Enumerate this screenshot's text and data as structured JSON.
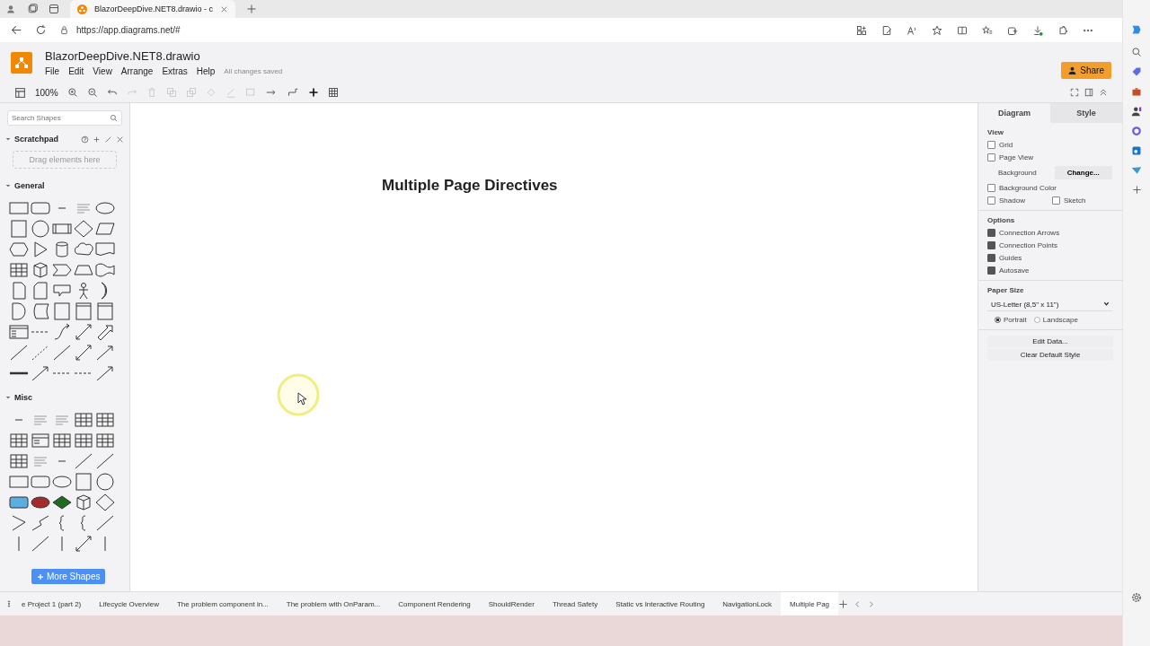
{
  "browser": {
    "tab_title": "BlazorDeepDive.NET8.drawio - c",
    "url": "https://app.diagrams.net/#"
  },
  "app": {
    "file_name": "BlazorDeepDive.NET8.drawio",
    "menu": [
      "File",
      "Edit",
      "View",
      "Arrange",
      "Extras",
      "Help"
    ],
    "save_status": "All changes saved",
    "share_label": "Share",
    "zoom": "100%"
  },
  "sidebar": {
    "search_placeholder": "Search Shapes",
    "scratchpad": {
      "title": "Scratchpad",
      "drop_hint": "Drag elements here"
    },
    "sections": [
      {
        "title": "General",
        "expanded": true
      },
      {
        "title": "Misc",
        "expanded": true
      }
    ],
    "more_shapes": "More Shapes"
  },
  "canvas": {
    "heading": "Multiple Page Directives"
  },
  "format_panel": {
    "tabs": [
      {
        "label": "Diagram",
        "selected": true
      },
      {
        "label": "Style",
        "selected": false
      }
    ],
    "view": {
      "title": "View",
      "grid": {
        "label": "Grid",
        "checked": false
      },
      "page_view": {
        "label": "Page View",
        "checked": false
      },
      "background_label": "Background",
      "change_button": "Change...",
      "background_color": {
        "label": "Background Color",
        "checked": false
      },
      "shadow": {
        "label": "Shadow",
        "checked": false
      },
      "sketch": {
        "label": "Sketch",
        "checked": false
      }
    },
    "options": {
      "title": "Options",
      "items": [
        {
          "label": "Connection Arrows",
          "checked": true
        },
        {
          "label": "Connection Points",
          "checked": true
        },
        {
          "label": "Guides",
          "checked": true
        },
        {
          "label": "Autosave",
          "checked": true
        }
      ]
    },
    "paper_size": {
      "title": "Paper Size",
      "value": "US-Letter (8,5\" x 11\")",
      "orientations": [
        {
          "label": "Portrait",
          "selected": true
        },
        {
          "label": "Landscape",
          "selected": false
        }
      ]
    },
    "buttons": [
      "Edit Data...",
      "Clear Default Style"
    ]
  },
  "page_tabs": [
    {
      "label": "e Project 1 (part 2)",
      "selected": false
    },
    {
      "label": "Lifecycle Overview",
      "selected": false
    },
    {
      "label": "The problem component in...",
      "selected": false
    },
    {
      "label": "The problem with OnParam...",
      "selected": false
    },
    {
      "label": "Component Rendering",
      "selected": false
    },
    {
      "label": "ShouldRender",
      "selected": false
    },
    {
      "label": "Thread Safety",
      "selected": false
    },
    {
      "label": "Static vs Interactive Routing",
      "selected": false
    },
    {
      "label": "NavigationLock",
      "selected": false
    },
    {
      "label": "Multiple Pag",
      "selected": true
    }
  ]
}
